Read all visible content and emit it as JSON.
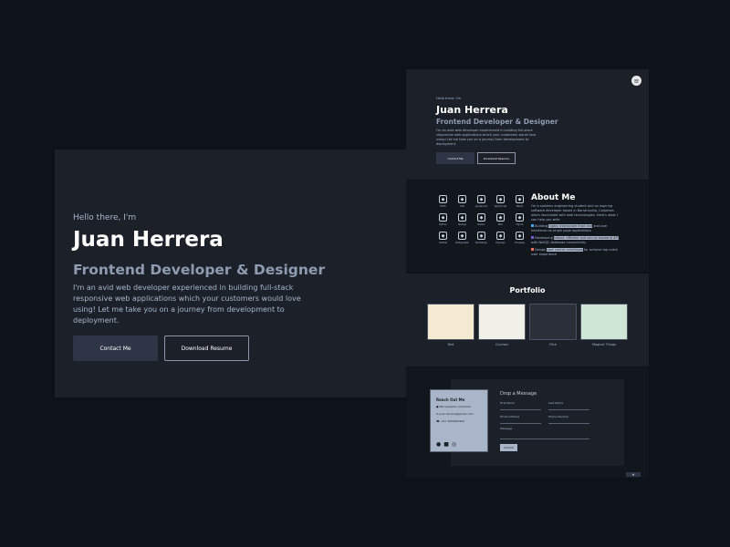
{
  "hero": {
    "greeting": "Hello there, I'm",
    "name": "Juan Herrera",
    "role": "Frontend Developer & Designer",
    "description": "I'm an avid web developer experienced in building full-stack responsive web applications which your customers would love using! Let me take you on a journey from development to deployment.",
    "contact_button": "Contact Me",
    "resume_button": "Download Resume"
  },
  "about": {
    "title": "About Me",
    "intro": "I'm a systems engineering student and an aspiring software developer based in Barranquilla, Colombia who's fascinated with web technologies. Here's what I can help you with:",
    "bullets": [
      {
        "pre": "Building",
        "hl": "highly interactive front end",
        "post": "and user interfaces as single page applications",
        "color": "#3fa9f5"
      },
      {
        "pre": "Developing",
        "hl": "robust, efficient and secure backend API",
        "post": "with NoSQL database connectivity",
        "color": "#7b5cd6"
      },
      {
        "pre": "Design",
        "hl": "user centric interfaces",
        "post": "for achieve top notch user experience",
        "color": "#e8735a"
      }
    ],
    "skills": [
      "HTML",
      "CSS",
      "JavaScript",
      "TypeScript",
      "React",
      "Python",
      "Nodejs",
      "Redux",
      "MUI",
      "Figma",
      "GitHub",
      "PostgreSQL",
      "Bootstrap",
      "Express",
      "Firebase"
    ]
  },
  "portfolio": {
    "title": "Portfolio",
    "items": [
      "Deli",
      "Courses",
      "Flick",
      "Magical Things"
    ]
  },
  "contact": {
    "card_title": "Reach Out Me",
    "location": "Barranquilla, Colombia",
    "email": "juan.herrera@gmail.com",
    "phone": "+57 3002300102",
    "form_title": "Drop a Message",
    "first_name": "First Name",
    "last_name": "Last Name",
    "email_label": "Email Address",
    "phone_label": "Phone Number",
    "message_label": "Message",
    "submit": "Submit"
  }
}
